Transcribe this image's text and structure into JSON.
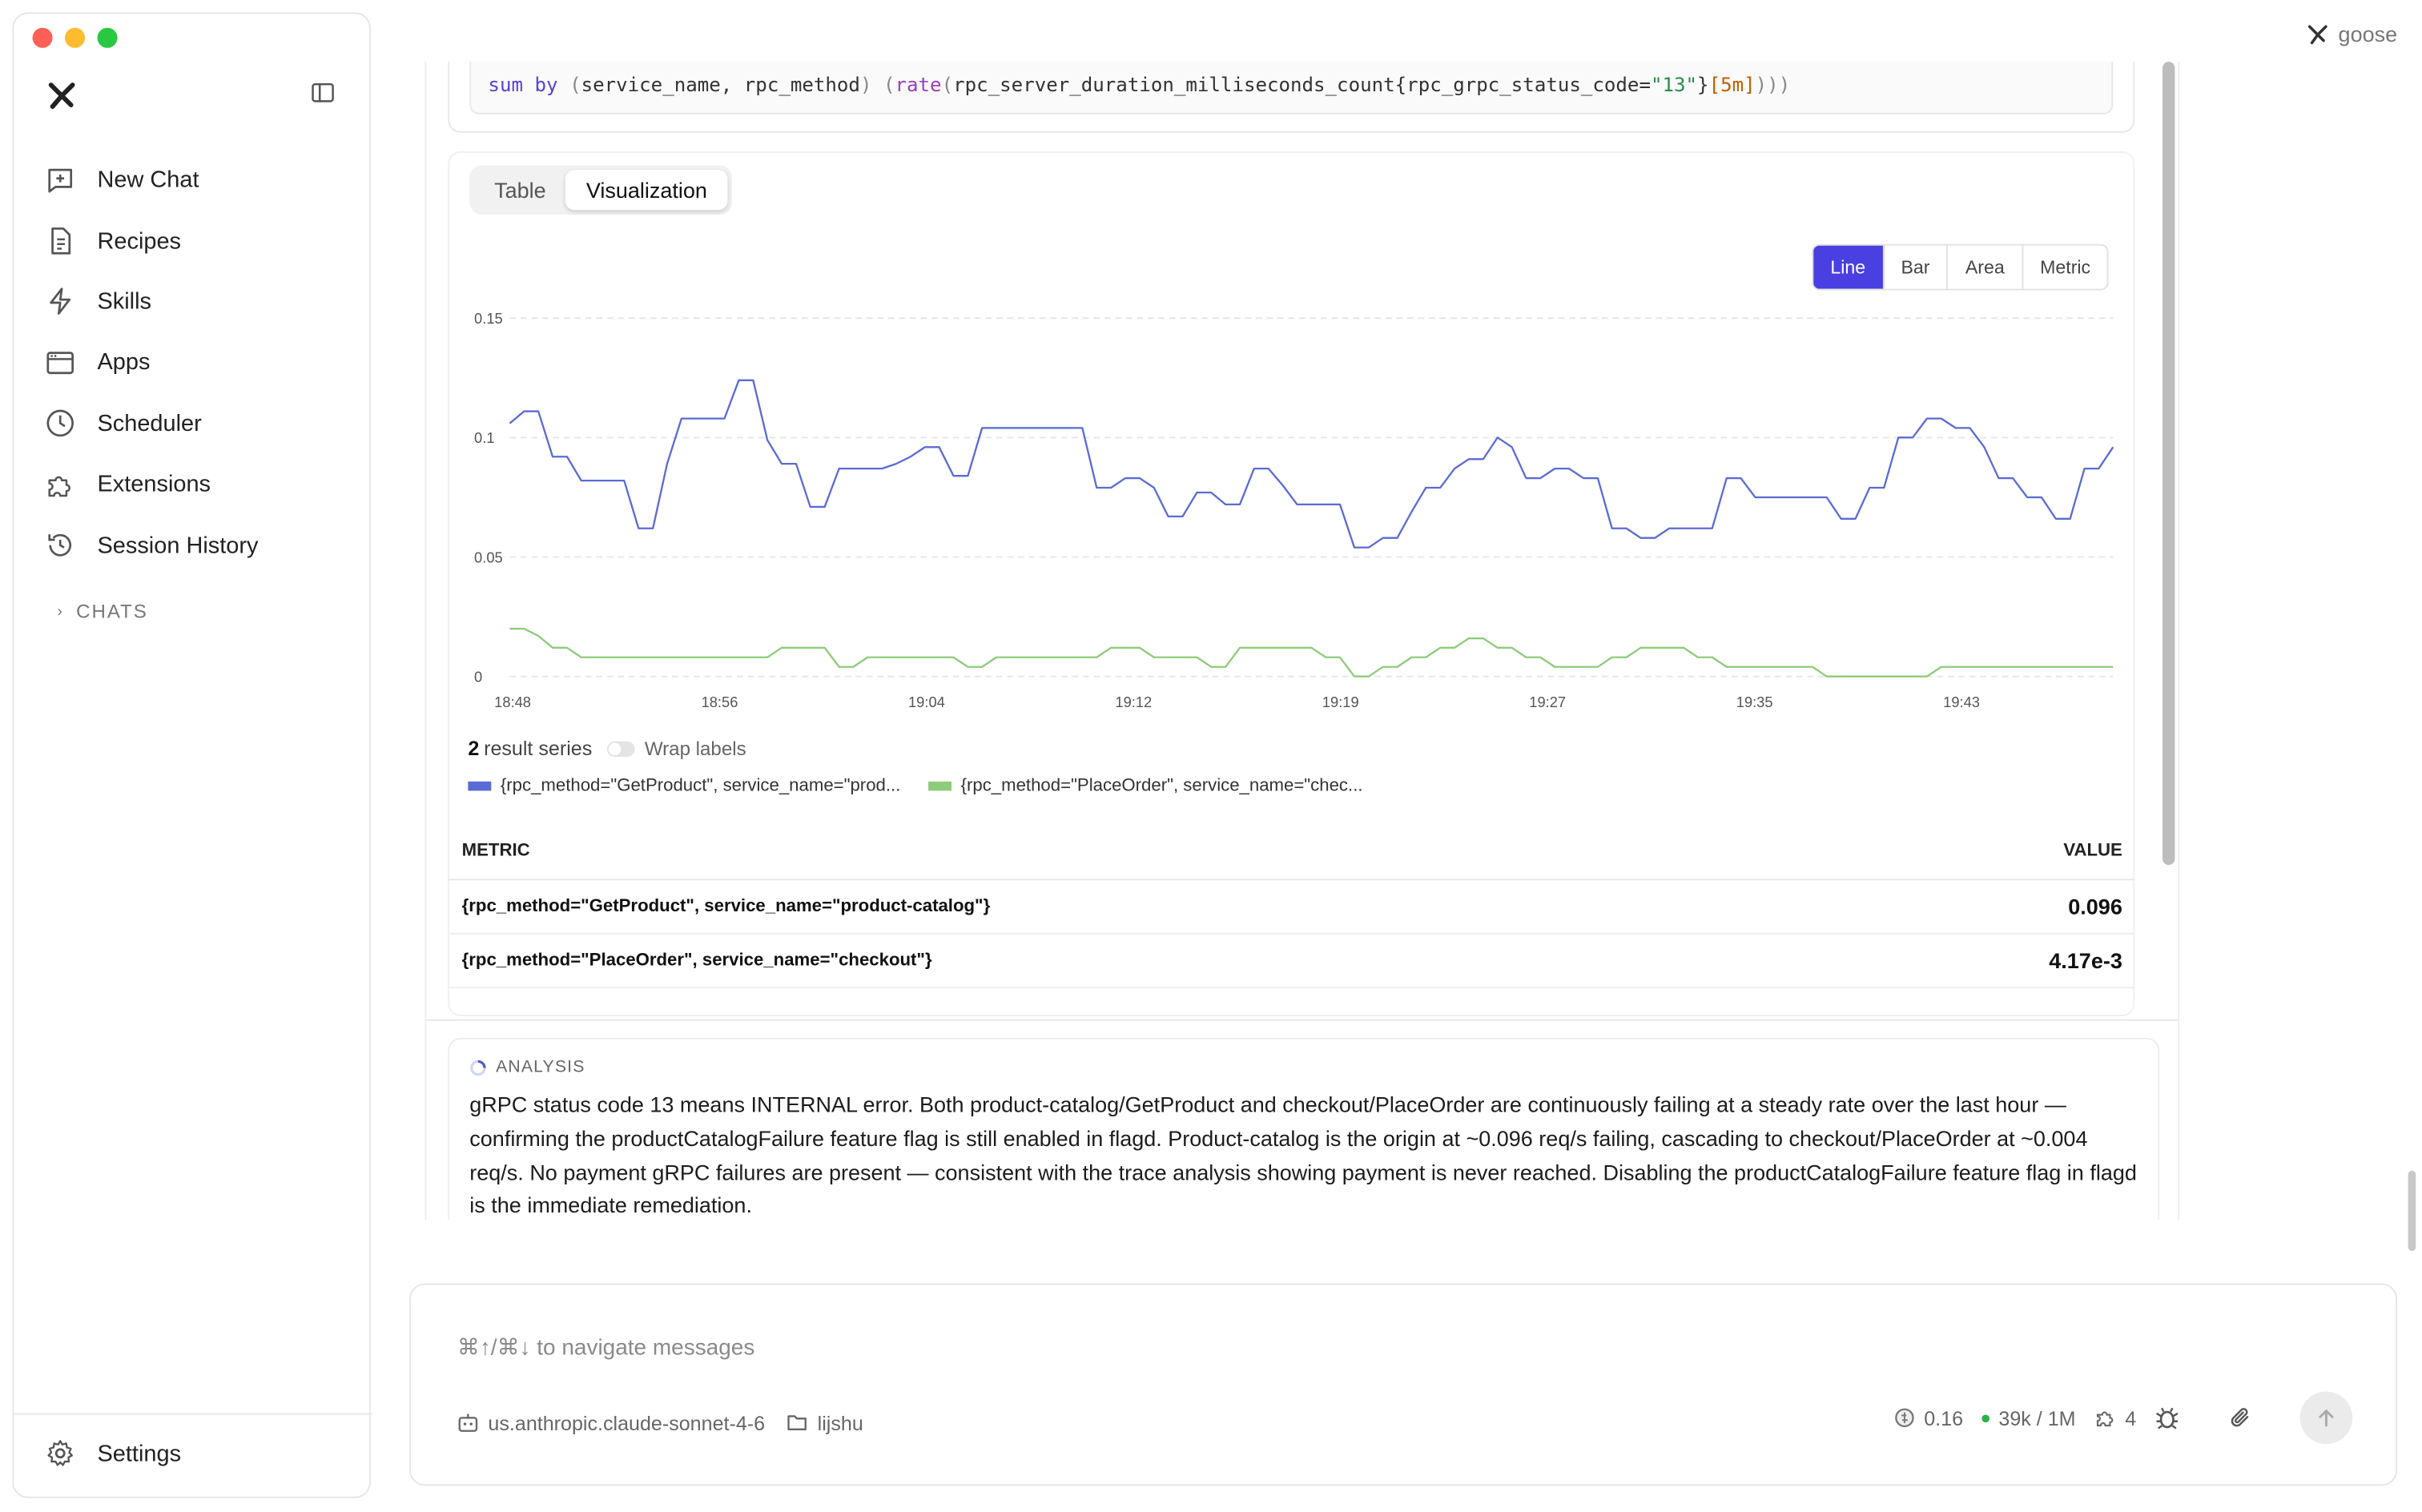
{
  "window": {
    "app_name": "goose"
  },
  "sidebar": {
    "items": [
      {
        "label": "New Chat",
        "icon": "new-chat-icon"
      },
      {
        "label": "Recipes",
        "icon": "recipe-icon"
      },
      {
        "label": "Skills",
        "icon": "bolt-icon"
      },
      {
        "label": "Apps",
        "icon": "apps-icon"
      },
      {
        "label": "Scheduler",
        "icon": "clock-icon"
      },
      {
        "label": "Extensions",
        "icon": "puzzle-icon"
      },
      {
        "label": "Session History",
        "icon": "history-icon"
      }
    ],
    "chats_label": "CHATS",
    "settings_label": "Settings"
  },
  "query": {
    "kw_sum": "sum",
    "kw_by": "by",
    "group_open": "(",
    "group_labels": "service_name, rpc_method",
    "group_close": ")",
    "outer_open": "(",
    "fn": "rate",
    "inner_open": "(",
    "metric": "rpc_server_duration_milliseconds_count",
    "brace_open": "{",
    "label_key": "rpc_grpc_status_code",
    "eq": "=",
    "label_val": "\"13\"",
    "brace_close": "}",
    "range_open": "[",
    "range": "5m",
    "range_close": "]",
    "closing": ")))"
  },
  "tabs": [
    "Table",
    "Visualization"
  ],
  "active_tab": "Visualization",
  "chart_types": [
    "Line",
    "Bar",
    "Area",
    "Metric"
  ],
  "selected_chart_type": "Line",
  "chart_data": {
    "type": "line",
    "title": "",
    "xlabel": "",
    "ylabel": "",
    "ylim": [
      0,
      0.15
    ],
    "y_ticks": [
      "0",
      "0.05",
      "0.1",
      "0.15"
    ],
    "x_ticks": [
      "18:48",
      "18:56",
      "19:04",
      "19:12",
      "19:19",
      "19:27",
      "19:35",
      "19:43"
    ],
    "grid": true,
    "legend_placement": "bottom",
    "series": [
      {
        "name": "{rpc_method=\"GetProduct\", service_name=\"prod...",
        "color": "#5b6bd5",
        "values": [
          0.106,
          0.111,
          0.111,
          0.092,
          0.092,
          0.082,
          0.082,
          0.082,
          0.082,
          0.062,
          0.062,
          0.089,
          0.108,
          0.108,
          0.108,
          0.108,
          0.124,
          0.124,
          0.099,
          0.089,
          0.089,
          0.071,
          0.071,
          0.087,
          0.087,
          0.087,
          0.087,
          0.089,
          0.092,
          0.096,
          0.096,
          0.084,
          0.084,
          0.104,
          0.104,
          0.104,
          0.104,
          0.104,
          0.104,
          0.104,
          0.104,
          0.079,
          0.079,
          0.083,
          0.083,
          0.079,
          0.067,
          0.067,
          0.077,
          0.077,
          0.072,
          0.072,
          0.087,
          0.087,
          0.08,
          0.072,
          0.072,
          0.072,
          0.072,
          0.054,
          0.054,
          0.058,
          0.058,
          0.069,
          0.079,
          0.079,
          0.087,
          0.091,
          0.091,
          0.1,
          0.096,
          0.083,
          0.083,
          0.087,
          0.087,
          0.083,
          0.083,
          0.062,
          0.062,
          0.058,
          0.058,
          0.062,
          0.062,
          0.062,
          0.062,
          0.083,
          0.083,
          0.075,
          0.075,
          0.075,
          0.075,
          0.075,
          0.075,
          0.066,
          0.066,
          0.079,
          0.079,
          0.1,
          0.1,
          0.108,
          0.108,
          0.104,
          0.104,
          0.096,
          0.083,
          0.083,
          0.075,
          0.075,
          0.066,
          0.066,
          0.087,
          0.087,
          0.096
        ]
      },
      {
        "name": "{rpc_method=\"PlaceOrder\", service_name=\"chec...",
        "color": "#8ecb7a",
        "values": [
          0.02,
          0.02,
          0.017,
          0.012,
          0.012,
          0.008,
          0.008,
          0.008,
          0.008,
          0.008,
          0.008,
          0.008,
          0.008,
          0.008,
          0.008,
          0.008,
          0.008,
          0.008,
          0.008,
          0.012,
          0.012,
          0.012,
          0.012,
          0.004,
          0.004,
          0.008,
          0.008,
          0.008,
          0.008,
          0.008,
          0.008,
          0.008,
          0.004,
          0.004,
          0.008,
          0.008,
          0.008,
          0.008,
          0.008,
          0.008,
          0.008,
          0.008,
          0.012,
          0.012,
          0.012,
          0.008,
          0.008,
          0.008,
          0.008,
          0.004,
          0.004,
          0.012,
          0.012,
          0.012,
          0.012,
          0.012,
          0.012,
          0.008,
          0.008,
          0.0,
          0.0,
          0.004,
          0.004,
          0.008,
          0.008,
          0.012,
          0.012,
          0.016,
          0.016,
          0.012,
          0.012,
          0.008,
          0.008,
          0.004,
          0.004,
          0.004,
          0.004,
          0.008,
          0.008,
          0.012,
          0.012,
          0.012,
          0.012,
          0.008,
          0.008,
          0.004,
          0.004,
          0.004,
          0.004,
          0.004,
          0.004,
          0.004,
          0.0,
          0.0,
          0.0,
          0.0,
          0.0,
          0.0,
          0.0,
          0.0,
          0.004,
          0.004,
          0.004,
          0.004,
          0.004,
          0.004,
          0.004,
          0.004,
          0.004,
          0.004,
          0.004,
          0.004,
          0.004
        ]
      }
    ]
  },
  "series_summary": {
    "count": "2",
    "count_label": "result series",
    "wrap_label": "Wrap labels"
  },
  "legend": [
    {
      "label": "{rpc_method=\"GetProduct\", service_name=\"prod...",
      "color": "#5b6bd5"
    },
    {
      "label": "{rpc_method=\"PlaceOrder\", service_name=\"chec...",
      "color": "#8ecb7a"
    }
  ],
  "metric_table": {
    "headers": {
      "metric": "METRIC",
      "value": "VALUE"
    },
    "rows": [
      {
        "metric": "{rpc_method=\"GetProduct\", service_name=\"product-catalog\"}",
        "value": "0.096"
      },
      {
        "metric": "{rpc_method=\"PlaceOrder\", service_name=\"checkout\"}",
        "value": "4.17e-3"
      }
    ]
  },
  "analysis": {
    "label": "ANALYSIS",
    "text": "gRPC status code 13 means INTERNAL error. Both product-catalog/GetProduct and checkout/PlaceOrder are continuously failing at a steady rate over the last hour — confirming the productCatalogFailure feature flag is still enabled in flagd. Product-catalog is the origin at ~0.096 req/s failing, cascading to checkout/PlaceOrder at ~0.004 req/s. No payment gRPC failures are present — consistent with the trace analysis showing payment is never reached. Disabling the productCatalogFailure feature flag in flagd is the immediate remediation."
  },
  "composer": {
    "placeholder": "⌘↑/⌘↓ to navigate messages",
    "model": "us.anthropic.claude-sonnet-4-6",
    "directory": "lijshu",
    "cost": "0.16",
    "tokens": "39k / 1M",
    "extensions_count": "4"
  }
}
